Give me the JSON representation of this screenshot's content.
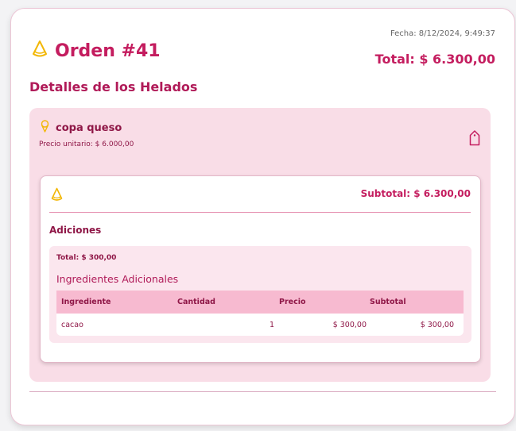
{
  "order": {
    "fecha": "Fecha: 8/12/2024, 9:49:37",
    "title": "Orden #41",
    "total": "Total: $ 6.300,00"
  },
  "details": {
    "section_title": "Detalles de los Helados",
    "item": {
      "name": "copa queso",
      "unit_price": "Precio unitario: $ 6.000,00",
      "subtotal": "Subtotal: $ 6.300,00",
      "adiciones_title": "Adiciones",
      "adiciones_total": "Total: $ 300,00",
      "ingredientes_title": "Ingredientes Adicionales",
      "table": {
        "headers": [
          "Ingrediente",
          "Cantidad",
          "Precio",
          "Subtotal"
        ],
        "rows": [
          [
            "cacao",
            "1",
            "$ 300,00",
            "$ 300,00"
          ]
        ]
      }
    }
  },
  "icons": {
    "cone": "ice-cream-cone-icon",
    "item": "ice-cream-icon",
    "tag": "tag-icon"
  },
  "colors": {
    "accent": "#c41d5f",
    "item_bg": "#f9dde7",
    "table_header": "#f7bad0",
    "icon_yellow": "#f2b705"
  }
}
